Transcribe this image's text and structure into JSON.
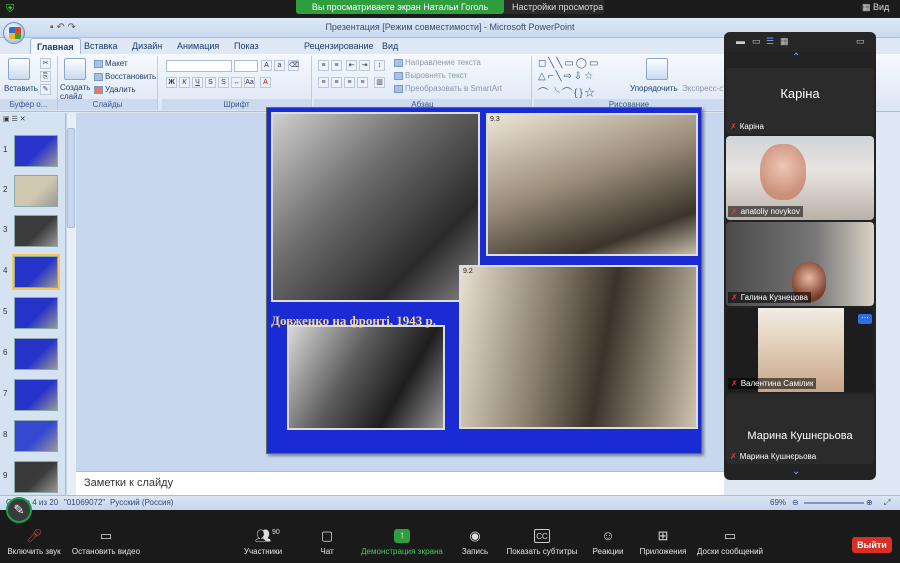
{
  "share_bar": {
    "banner": "Вы просматриваете экран Натальи Гоголь",
    "settings": "Настройки просмотра",
    "view": "Вид"
  },
  "window": {
    "title": "Презентация [Режим совместимости] - Microsoft PowerPoint",
    "tabs": [
      "Главная",
      "Вставка",
      "Дизайн",
      "Анимация",
      "Показ слайдов",
      "Рецензирование",
      "Вид"
    ]
  },
  "ribbon": {
    "clipboard": {
      "paste": "Вставить",
      "label": "Буфер о..."
    },
    "slides": {
      "new_slide": "Создать слайд",
      "layout": "Макет",
      "reset": "Восстановить",
      "delete": "Удалить",
      "label": "Слайды"
    },
    "font": {
      "label": "Шрифт"
    },
    "paragraph": {
      "text_direction": "Направление текста",
      "align_text": "Выровнять текст",
      "smartart": "Преобразовать в SmartArt",
      "label": "Абзац"
    },
    "drawing": {
      "arrange": "Упорядочить",
      "quick_styles": "Экспресс-сти...",
      "label": "Рисование"
    }
  },
  "slides_panel": {
    "numbers": [
      "1",
      "2",
      "3",
      "4",
      "5",
      "6",
      "7",
      "8",
      "9"
    ],
    "selected": "4"
  },
  "slide": {
    "caption": "Довженко на фронті, 1943 р.",
    "photo_labels": [
      "9.3",
      "9.2"
    ]
  },
  "notes": {
    "placeholder": "Заметки к слайду"
  },
  "status_bar": {
    "slide_counter": "Слайд 4 из 20",
    "theme": "\"01069072\"",
    "language": "Русский (Россия)",
    "zoom": "69%"
  },
  "participants_gallery": [
    {
      "name": "Каріна",
      "display": "Каріна",
      "video": false
    },
    {
      "name": "anatoliy novykov",
      "video": true
    },
    {
      "name": "Галина Кузнецова",
      "video": true
    },
    {
      "name": "Валентина Самілик",
      "video": true
    },
    {
      "name": "Марина Кушнєрьова",
      "display": "Марина Кушнєрьова",
      "video": false
    }
  ],
  "toolbar": {
    "mute": "Включить звук",
    "video": "Остановить видео",
    "participants": "Участники",
    "participants_count": "90",
    "chat": "Чат",
    "share": "Демонстрация экрана",
    "record": "Запись",
    "captions": "Показать субтитры",
    "reactions": "Реакции",
    "apps": "Приложения",
    "whiteboards": "Доски сообщений",
    "exit": "Выйти"
  },
  "colors": {
    "share_green": "#2e9e3e",
    "exit_red": "#d93025",
    "slide_blue": "#1a2bd4",
    "caption_gold": "#f3d88a"
  }
}
